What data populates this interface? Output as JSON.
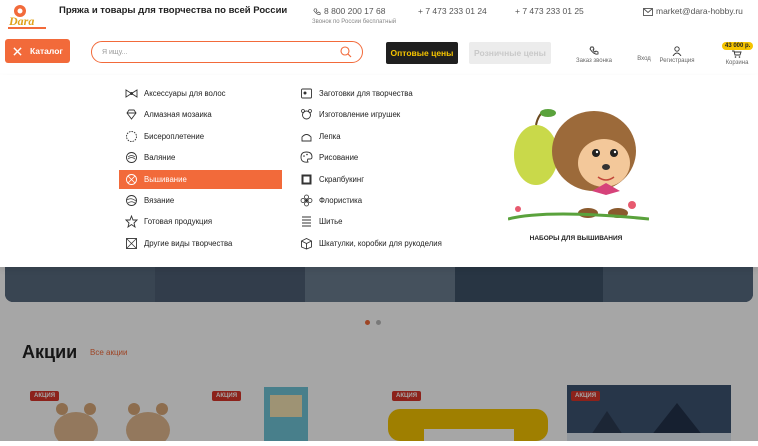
{
  "top": {
    "slogan": "Пряжа и товары для творчества по всей России",
    "phones": [
      "8 800 200 17 68",
      "+ 7 473 233 01 24",
      "+ 7 473 233 01 25"
    ],
    "phone_note": "Звонок по России бесплатный",
    "email": "market@dara-hobby.ru",
    "logo_text": "Dara"
  },
  "header": {
    "catalog_label": "Каталог",
    "search_placeholder": "Я ищу...",
    "wholesale_label": "Оптовые цены",
    "retail_label": "Розничные цены",
    "callback_label": "Заказ звонка",
    "login_label": "Вход",
    "register_label": "Регистрация",
    "cart_label": "Корзина",
    "cart_total": "43 000 р."
  },
  "menu": {
    "col1": [
      {
        "label": "Аксессуары для волос",
        "icon": "bow-icon"
      },
      {
        "label": "Алмазная мозаика",
        "icon": "diamond-icon"
      },
      {
        "label": "Бисероплетение",
        "icon": "beads-icon"
      },
      {
        "label": "Валяние",
        "icon": "felt-icon"
      },
      {
        "label": "Вышивание",
        "icon": "embroidery-icon",
        "active": true
      },
      {
        "label": "Вязание",
        "icon": "yarn-icon"
      },
      {
        "label": "Готовая продукция",
        "icon": "star-icon"
      },
      {
        "label": "Другие виды творчества",
        "icon": "grid-icon"
      }
    ],
    "col2": [
      {
        "label": "Заготовки для творчества",
        "icon": "blank-icon"
      },
      {
        "label": "Изготовление игрушек",
        "icon": "toy-icon"
      },
      {
        "label": "Лепка",
        "icon": "clay-icon"
      },
      {
        "label": "Рисование",
        "icon": "palette-icon"
      },
      {
        "label": "Скрапбукинг",
        "icon": "scrapbook-icon"
      },
      {
        "label": "Флористика",
        "icon": "flower-icon"
      },
      {
        "label": "Шитье",
        "icon": "sewing-icon"
      },
      {
        "label": "Шкатулки, коробки для рукоделия",
        "icon": "box-icon"
      }
    ],
    "promo_caption": "НАБОРЫ ДЛЯ ВЫШИВАНИЯ"
  },
  "sales": {
    "title": "Акции",
    "all_link": "Все акции",
    "badge": "АКЦИЯ"
  },
  "colors": {
    "accent": "#f26a3a",
    "dark": "#1f1f1f",
    "yellow": "#f5c400"
  }
}
